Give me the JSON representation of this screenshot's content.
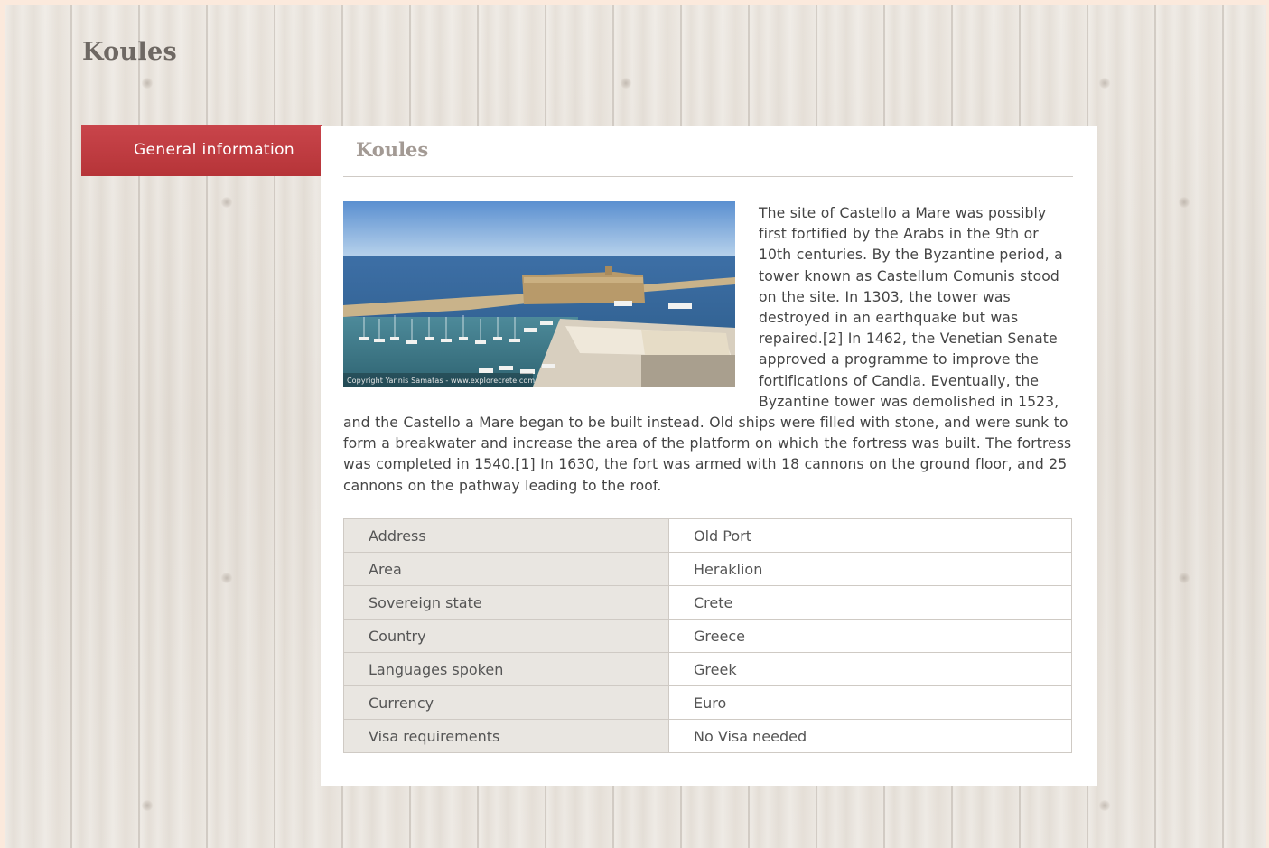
{
  "page": {
    "title": "Koules"
  },
  "tab": {
    "label": "General information"
  },
  "panel": {
    "title": "Koules",
    "photo": {
      "alt": "Koules fortress at the Venetian harbour of Heraklion",
      "credit": "Copyright Yannis Samatas - www.explorecrete.com"
    },
    "description": "The site of Castello a Mare was possibly first fortified by the Arabs in the 9th or 10th centuries. By the Byzantine period, a tower known as Castellum Comunis stood on the site. In 1303, the tower was destroyed in an earthquake but was repaired.[2] In 1462, the Venetian Senate approved a programme to improve the fortifications of Candia. Eventually, the Byzantine tower was demolished in 1523, and the Castello a Mare began to be built instead. Old ships were filled with stone, and were sunk to form a breakwater and increase the area of the platform on which the fortress was built. The fortress was completed in 1540.[1] In 1630, the fort was armed with 18 cannons on the ground floor, and 25 cannons on the pathway leading to the roof."
  },
  "info": [
    {
      "label": "Address",
      "value": "Old Port"
    },
    {
      "label": "Area",
      "value": "Heraklion"
    },
    {
      "label": "Sovereign state",
      "value": "Crete"
    },
    {
      "label": "Country",
      "value": "Greece"
    },
    {
      "label": "Languages spoken",
      "value": "Greek"
    },
    {
      "label": "Currency",
      "value": "Euro"
    },
    {
      "label": "Visa requirements",
      "value": "No Visa needed"
    }
  ],
  "colors": {
    "tab_accent": "#be3c41",
    "page_border": "#fbe9dc",
    "heading": "#6e6863"
  }
}
